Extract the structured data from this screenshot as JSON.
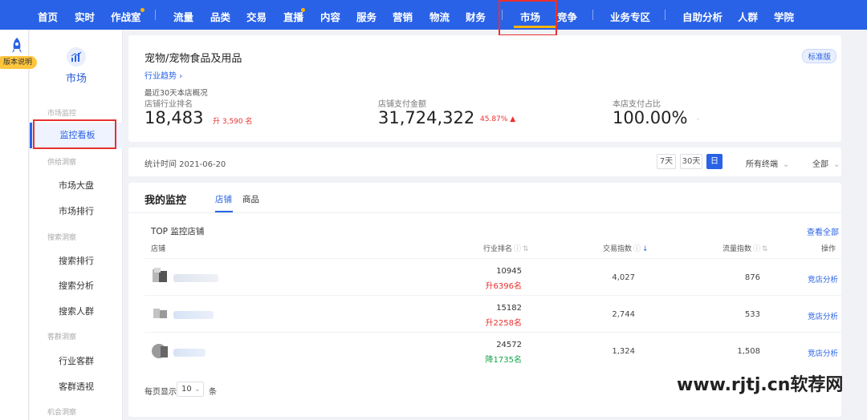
{
  "topnav": {
    "items": [
      "首页",
      "实时",
      "作战室",
      "流量",
      "品类",
      "交易",
      "直播",
      "内容",
      "服务",
      "营销",
      "物流",
      "财务",
      "市场",
      "竞争",
      "业务专区",
      "自助分析",
      "人群",
      "学院"
    ],
    "active": "市场"
  },
  "rail": {
    "badge": "版本说明"
  },
  "sidebar": {
    "title": "市场",
    "groups": [
      "市场监控",
      "供给洞察",
      "搜索洞察",
      "客群洞察",
      "机会洞察"
    ],
    "links": [
      "监控看板",
      "市场大盘",
      "市场排行",
      "搜索排行",
      "搜索分析",
      "搜索人群",
      "行业客群",
      "客群透视"
    ],
    "active": "监控看板"
  },
  "overview": {
    "title": "宠物/宠物食品及用品",
    "badge": "标准版",
    "trend_link": "行业趋势",
    "subtitle": "最近30天本店概况",
    "metrics": [
      {
        "label": "店铺行业排名",
        "value": "18,483",
        "delta": "升 3,590 名"
      },
      {
        "label": "店铺支付金额",
        "value": "31,724,322",
        "delta": "45.87%"
      },
      {
        "label": "本店支付占比",
        "value": "100.00%",
        "delta": "-"
      }
    ]
  },
  "filter": {
    "stat_time": "统计时间 2021-06-20",
    "ranges": [
      "7天",
      "30天",
      "日"
    ],
    "active_range": "日",
    "terminal": "所有终端",
    "scope": "全部"
  },
  "monitor": {
    "title": "我的监控",
    "tabs": [
      "店铺",
      "商品"
    ],
    "active_tab": "店铺",
    "top_label": "TOP 监控店铺",
    "view_all": "查看全部",
    "columns": [
      "店铺",
      "行业排名",
      "交易指数",
      "流量指数",
      "操作"
    ],
    "rows": [
      {
        "rank": "10945",
        "change": "升6396名",
        "dir": "up",
        "trade": "4,027",
        "traffic": "876",
        "action": "竞店分析"
      },
      {
        "rank": "15182",
        "change": "升2258名",
        "dir": "up",
        "trade": "2,744",
        "traffic": "533",
        "action": "竞店分析"
      },
      {
        "rank": "24572",
        "change": "降1735名",
        "dir": "down",
        "trade": "1,324",
        "traffic": "1,508",
        "action": "竞店分析"
      }
    ],
    "pager": {
      "label": "每页显示",
      "size": "10",
      "unit": "条"
    }
  },
  "watermark": "www.rjtj.cn软荐网",
  "colors": {
    "primary": "#2962e6",
    "up": "#e8312f",
    "down": "#16a34a",
    "highlight": "#ffb400"
  }
}
